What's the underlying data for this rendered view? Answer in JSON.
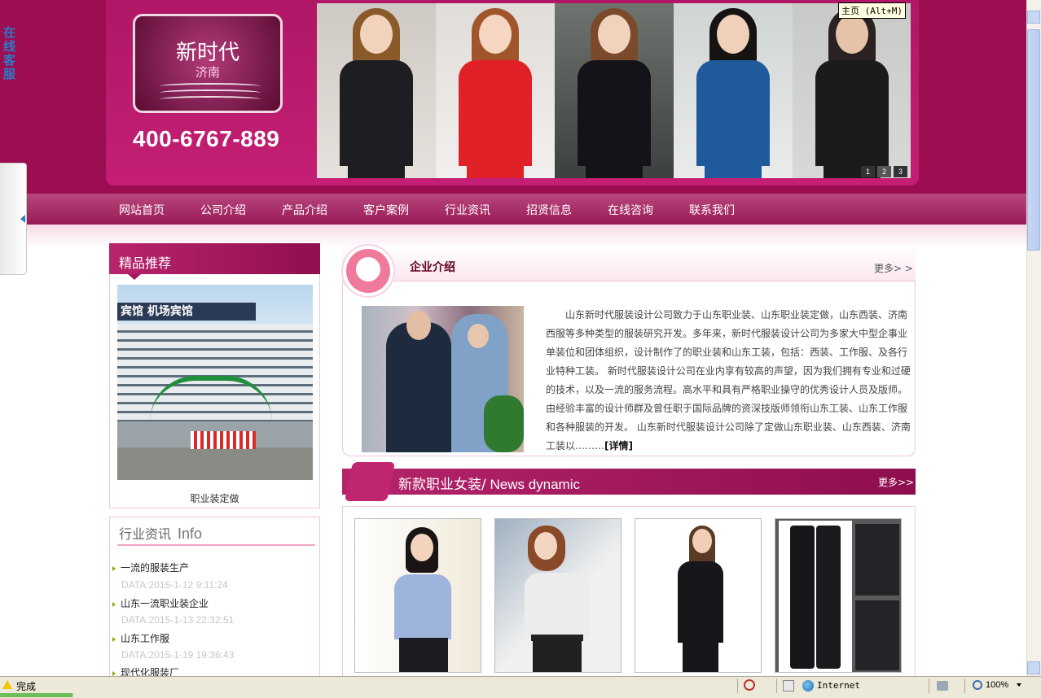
{
  "header": {
    "logo_text": "新时代",
    "logo_sub": "济南",
    "phone": "400-6767-889",
    "tooltip": "主页 (Alt+M)",
    "slide_numbers": [
      "1",
      "2",
      "3"
    ]
  },
  "side_tab": {
    "label": "在线客服"
  },
  "nav": {
    "items": [
      {
        "label": "网站首页"
      },
      {
        "label": "公司介绍"
      },
      {
        "label": "产品介绍"
      },
      {
        "label": "客户案例"
      },
      {
        "label": "行业资讯"
      },
      {
        "label": "招贤信息"
      },
      {
        "label": "在线咨询"
      },
      {
        "label": "联系我们"
      }
    ]
  },
  "recommend": {
    "title": "精品推荐",
    "caption": "职业装定做",
    "sign_text": "宾馆 机场宾馆"
  },
  "info": {
    "title": "行业资讯",
    "title_en": "Info",
    "items": [
      {
        "title": "一流的服装生产",
        "date": "DATA:2015-1-12 9:11:24"
      },
      {
        "title": "山东一流职业装企业",
        "date": "DATA:2015-1-13 22:32:51"
      },
      {
        "title": "山东工作服",
        "date": "DATA:2015-1-19 19:36:43"
      },
      {
        "title": "现代化服装厂",
        "date": ""
      }
    ]
  },
  "intro": {
    "title": "企业介绍",
    "more": "更多> >",
    "text": "山东新时代服装设计公司致力于山东职业装、山东职业装定做，山东西装、济南西服等多种类型的服装研究开发。多年来，新时代服装设计公司为多家大中型企事业单装位和团体组织，设计制作了的职业装和山东工装，包括：西装、工作服、及各行业特种工装。 新时代服装设计公司在业内享有较高的声望，因为我们拥有专业和过硬的技术，以及一流的服务流程。高水平和具有严格职业操守的优秀设计人员及版师。由经验丰富的设计师群及曾任职于国际品牌的资深技版师领衔山东工装、山东工作服和各种服装的开发。 山东新时代服装设计公司除了定做山东职业装、山东西装、济南工装以………",
    "detail": "[详情]"
  },
  "new_products": {
    "title": "新款职业女装/",
    "title_en": " News dynamic",
    "more": "更多>>"
  },
  "statusbar": {
    "status": "完成",
    "zone": "Internet",
    "zoom": "100%"
  },
  "colors": {
    "brand": "#9c0d52",
    "accent": "#c41f74",
    "nav": "#a52a63"
  }
}
